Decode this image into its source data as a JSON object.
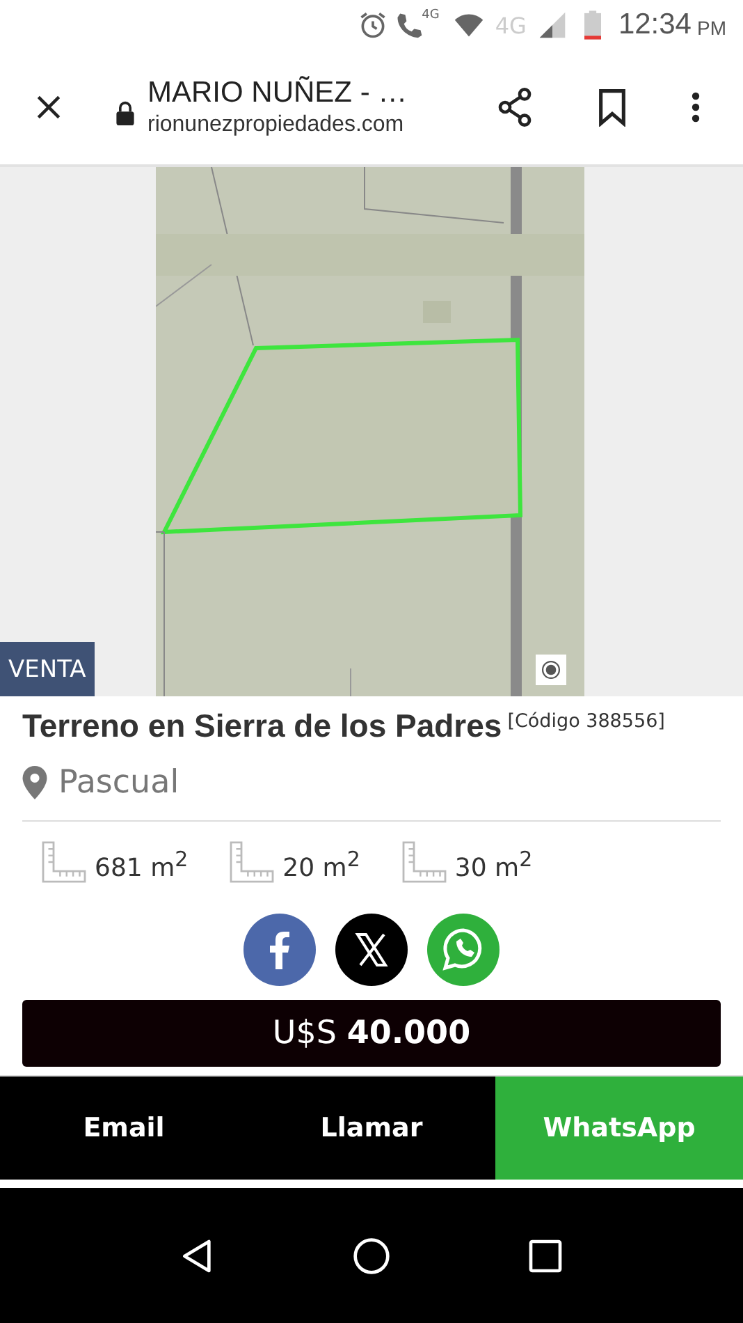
{
  "status_bar": {
    "call_badge": "4G",
    "network": "4G",
    "time": "12:34",
    "ampm": "PM"
  },
  "browser": {
    "title": "MARIO NUÑEZ - …",
    "url": "rionunezpropiedades.com"
  },
  "listing": {
    "badge": "VENTA",
    "title": "Terreno en Sierra de los Padres",
    "code": "[Código 388556]",
    "location": "Pascual",
    "areas": [
      "681 m$^{2}$",
      "20 m$^{2}$",
      "30 m$^{2}$"
    ],
    "share": [
      {
        "kind": "facebook"
      },
      {
        "kind": "x"
      },
      {
        "kind": "whatsapp"
      }
    ],
    "price": "U$S **40.000**"
  },
  "actions": [
    {
      "label": "Email",
      "color": "#000000"
    },
    {
      "label": "Llamar",
      "color": "#000000"
    },
    {
      "label": "WhatsApp",
      "color": "#2fb03c"
    }
  ]
}
